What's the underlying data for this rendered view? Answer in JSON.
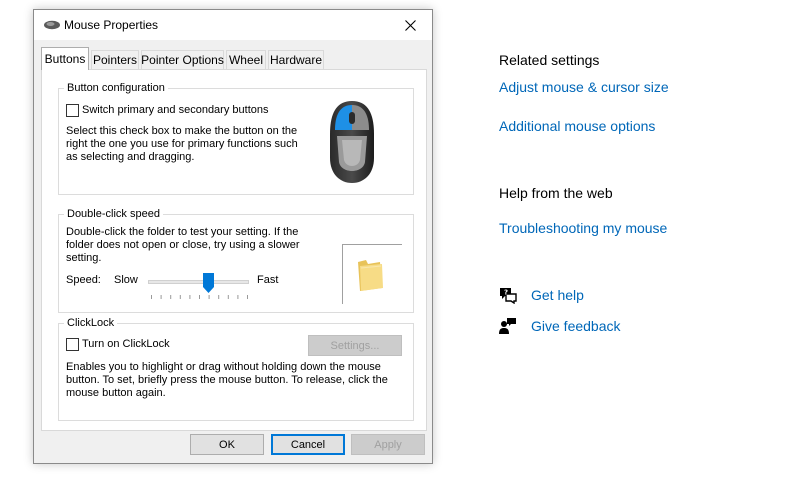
{
  "dialog": {
    "title": "Mouse Properties",
    "tabs": [
      "Buttons",
      "Pointers",
      "Pointer Options",
      "Wheel",
      "Hardware"
    ],
    "button_config": {
      "group_title": "Button configuration",
      "checkbox_label": "Switch primary and secondary buttons",
      "description": "Select this check box to make the button on the right the one you use for primary functions such as selecting and dragging."
    },
    "double_click": {
      "group_title": "Double-click speed",
      "description": "Double-click the folder to test your setting. If the folder does not open or close, try using a slower setting.",
      "speed_label": "Speed:",
      "slow_label": "Slow",
      "fast_label": "Fast",
      "speed_value": 0.6
    },
    "clicklock": {
      "group_title": "ClickLock",
      "checkbox_label": "Turn on ClickLock",
      "settings_button": "Settings...",
      "description": "Enables you to highlight or drag without holding down the mouse button. To set, briefly press the mouse button. To release, click the mouse button again."
    },
    "buttons": {
      "ok": "OK",
      "cancel": "Cancel",
      "apply": "Apply"
    }
  },
  "related_settings": {
    "heading": "Related settings",
    "links": [
      "Adjust mouse & cursor size",
      "Additional mouse options"
    ]
  },
  "help_web": {
    "heading": "Help from the web",
    "links": [
      "Troubleshooting my mouse"
    ]
  },
  "help_actions": {
    "get_help": "Get help",
    "give_feedback": "Give feedback"
  },
  "colors": {
    "link": "#0067b8",
    "accent": "#0078d7",
    "mouse_highlight": "#1e90e6"
  }
}
